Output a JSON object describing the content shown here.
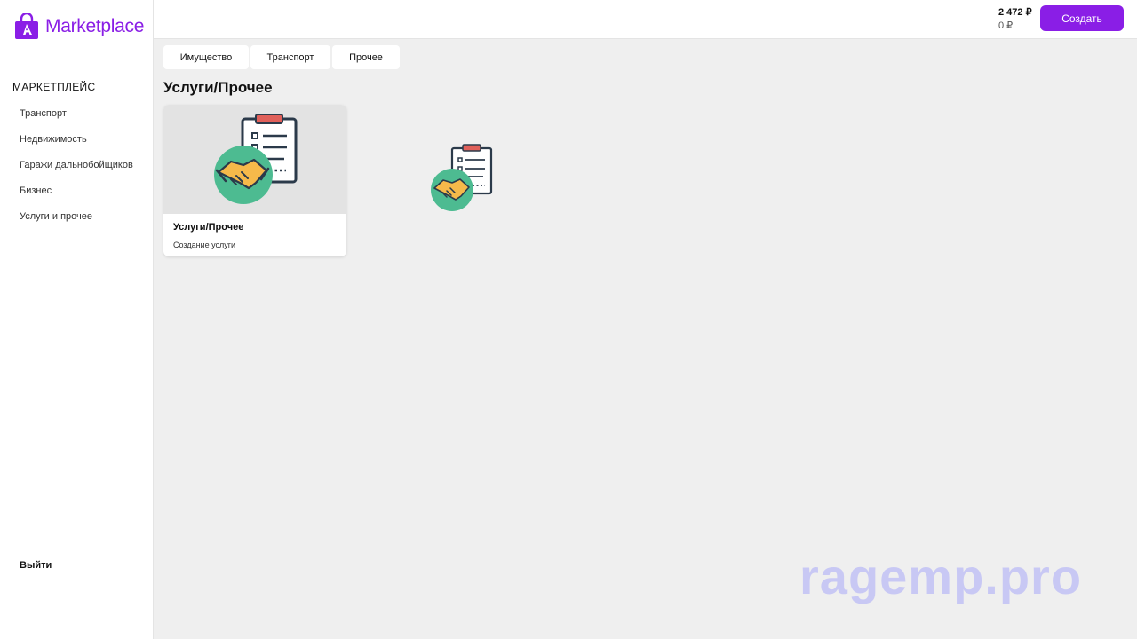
{
  "brand": {
    "name": "Marketplace",
    "icon": "shopping-bag-icon",
    "accent": "#8a1ee6"
  },
  "sidebar": {
    "heading": "МАРКЕТПЛЕЙС",
    "items": [
      {
        "label": "Транспорт"
      },
      {
        "label": "Недвижимость"
      },
      {
        "label": "Гаражи дальнобойщиков"
      },
      {
        "label": "Бизнес"
      },
      {
        "label": "Услуги и прочее"
      }
    ],
    "logout_label": "Выйти"
  },
  "header": {
    "balance_main": "2 472 ₽",
    "balance_secondary": "0 ₽",
    "create_label": "Создать"
  },
  "tabs": [
    {
      "label": "Имущество"
    },
    {
      "label": "Транспорт"
    },
    {
      "label": "Прочее"
    }
  ],
  "section": {
    "title": "Услуги/Прочее"
  },
  "cards": [
    {
      "title": "Услуги/Прочее",
      "subtitle": "Создание услуги",
      "icon": "handshake-checklist-icon"
    }
  ],
  "watermark": "ragemp.pro"
}
